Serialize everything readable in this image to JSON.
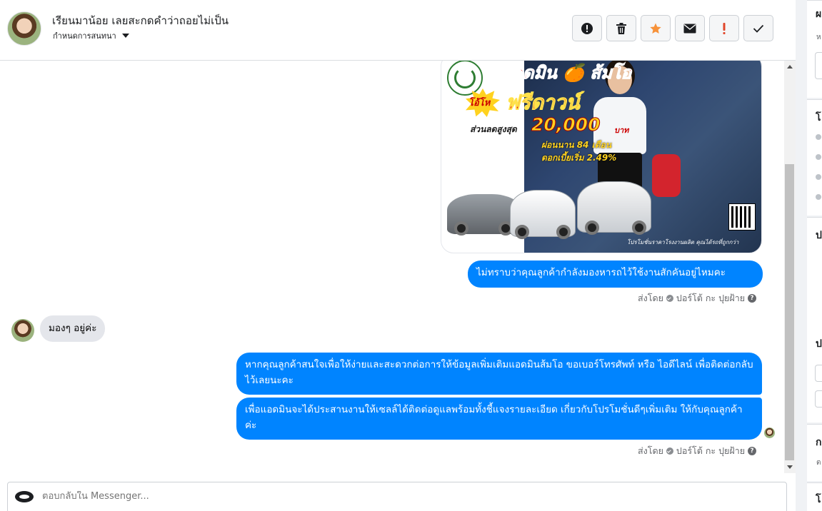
{
  "header": {
    "contact_name": "เรียนมาน้อย เลยสะกดคำว่าถอยไม่เป็น",
    "subtitle": "กำหนดการสนทนา",
    "actions": [
      {
        "name": "spam-button",
        "icon": "alert-circle-icon"
      },
      {
        "name": "delete-button",
        "icon": "trash-icon"
      },
      {
        "name": "star-button",
        "icon": "star-icon"
      },
      {
        "name": "mark-unread-button",
        "icon": "envelope-icon"
      },
      {
        "name": "important-button",
        "icon": "exclamation-icon"
      },
      {
        "name": "mark-done-button",
        "icon": "check-icon"
      }
    ]
  },
  "promo_image": {
    "title": "แอดมิน 🍊 ส้มโอ",
    "badge": "โอ้โห",
    "headline": "ฟรีดาวน์",
    "discount_label": "ส่วนลดสูงสุด",
    "discount_amount": "20,000",
    "discount_unit": "บาท",
    "installments": "ผ่อนนาน 84 เดือน",
    "interest": "ดอกเบี้ยเริ่ม 2.49%",
    "tagline": "โปรโมชั่นราคาโรงงานผลิต คุณได้รถที่ถูกกว่า"
  },
  "messages": {
    "out_1": "ไม่ทราบว่าคุณลูกค้ากำลังมองหารถไว้ใช้งานสักคันอยู่ไหมคะ",
    "in_1": "มองๆ อยู่ค่ะ",
    "out_2": "หากคุณลูกค้าสนใจเพื่อให้ง่ายและสะดวกต่อการให้ข้อมูลเพิ่มเติมแอดมินส้มโอ ขอเบอร์โทรศัพท์ หรือ ไอดีไลน์ เพื่อติดต่อกลับไว้เลยนะคะ",
    "out_3": "เพื่อแอดมินจะได้ประสานงานให้เซลล์ได้ติดต่อดูแลพร้อมทั้งชี้แจงรายละเอียด เกี่ยวกับโปรโมชั่นดีๆเพิ่มเติม ให้กับคุณลูกค้าค่ะ",
    "sent_by_prefix": "ส่งโดย",
    "sent_by_name": "ปอร์โต้ กะ ปุยฝ้าย",
    "help_glyph": "?"
  },
  "composer": {
    "placeholder": "ตอบกลับใน Messenger..."
  },
  "right_panel": {
    "labels": [
      "ผ",
      "ห",
      "โ",
      "ป",
      "ป",
      "ก",
      "ต",
      "โ"
    ]
  },
  "colors": {
    "outgoing_bubble": "#0084ff",
    "incoming_bubble": "#e4e6eb",
    "star": "#f7923a",
    "important": "#e0452a"
  }
}
